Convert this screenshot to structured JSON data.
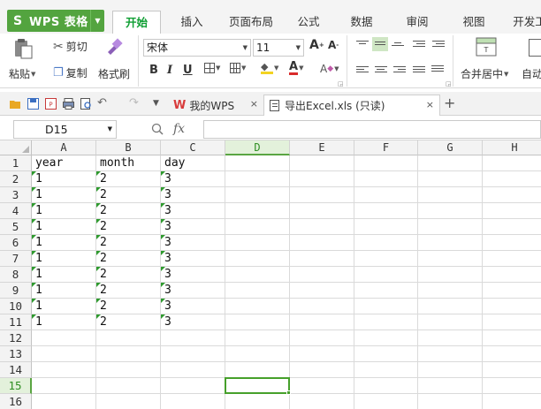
{
  "app": {
    "name": "WPS 表格"
  },
  "menu": {
    "tabs": [
      "开始",
      "插入",
      "页面布局",
      "公式",
      "数据",
      "审阅",
      "视图",
      "开发工"
    ]
  },
  "ribbon": {
    "cut_label": "剪切",
    "copy_label": "复制",
    "paste_label": "粘贴",
    "format_painter_label": "格式刷",
    "font_name": "宋体",
    "font_size": "11",
    "bold": "B",
    "italic": "I",
    "underline": "U",
    "merge_label": "合并居中",
    "auto_wrap_label": "自动"
  },
  "doc_tabs": {
    "home_label": "我的WPS",
    "file_label": "导出Excel.xls (只读)"
  },
  "formula_bar": {
    "name_box": "D15",
    "fx_label": "fx",
    "formula_value": ""
  },
  "sheet": {
    "columns": [
      "A",
      "B",
      "C",
      "D",
      "E",
      "F",
      "G",
      "H"
    ],
    "active_column": "D",
    "active_row": "15",
    "rows": [
      {
        "num": "1",
        "a": "year",
        "b": "month",
        "c": "day"
      },
      {
        "num": "2",
        "a": "1",
        "b": "2",
        "c": "3"
      },
      {
        "num": "3",
        "a": "1",
        "b": "2",
        "c": "3"
      },
      {
        "num": "4",
        "a": "1",
        "b": "2",
        "c": "3"
      },
      {
        "num": "5",
        "a": "1",
        "b": "2",
        "c": "3"
      },
      {
        "num": "6",
        "a": "1",
        "b": "2",
        "c": "3"
      },
      {
        "num": "7",
        "a": "1",
        "b": "2",
        "c": "3"
      },
      {
        "num": "8",
        "a": "1",
        "b": "2",
        "c": "3"
      },
      {
        "num": "9",
        "a": "1",
        "b": "2",
        "c": "3"
      },
      {
        "num": "10",
        "a": "1",
        "b": "2",
        "c": "3"
      },
      {
        "num": "11",
        "a": "1",
        "b": "2",
        "c": "3"
      },
      {
        "num": "12",
        "a": "",
        "b": "",
        "c": ""
      },
      {
        "num": "13",
        "a": "",
        "b": "",
        "c": ""
      },
      {
        "num": "14",
        "a": "",
        "b": "",
        "c": ""
      },
      {
        "num": "15",
        "a": "",
        "b": "",
        "c": ""
      },
      {
        "num": "16",
        "a": "",
        "b": "",
        "c": ""
      }
    ]
  },
  "colors": {
    "brand_green": "#53a43f",
    "selection_green": "#46a02b",
    "text_as_number_marker": "#2e9a2e"
  }
}
